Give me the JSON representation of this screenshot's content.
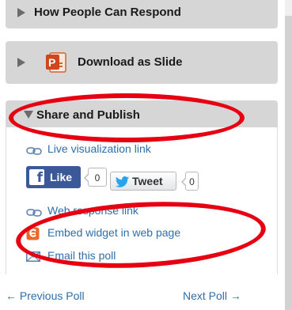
{
  "panels": {
    "respond": {
      "label": "How People Can Respond"
    },
    "download": {
      "label": "Download as Slide",
      "icon": "powerpoint-icon"
    },
    "share": {
      "label": "Share and Publish"
    }
  },
  "share_links": {
    "live": "Live visualization link",
    "web": "Web response link",
    "embed": "Embed widget in web page",
    "email": "Email this poll"
  },
  "social": {
    "like_label": "Like",
    "like_count": "0",
    "tweet_label": "Tweet",
    "tweet_count": "0"
  },
  "pagination": {
    "prev": "← Previous Poll",
    "next": "Next Poll →"
  },
  "colors": {
    "link": "#2f6ea8",
    "panel_bg": "#d6d6d6",
    "annotation": "#e60012",
    "facebook": "#3b5998"
  }
}
